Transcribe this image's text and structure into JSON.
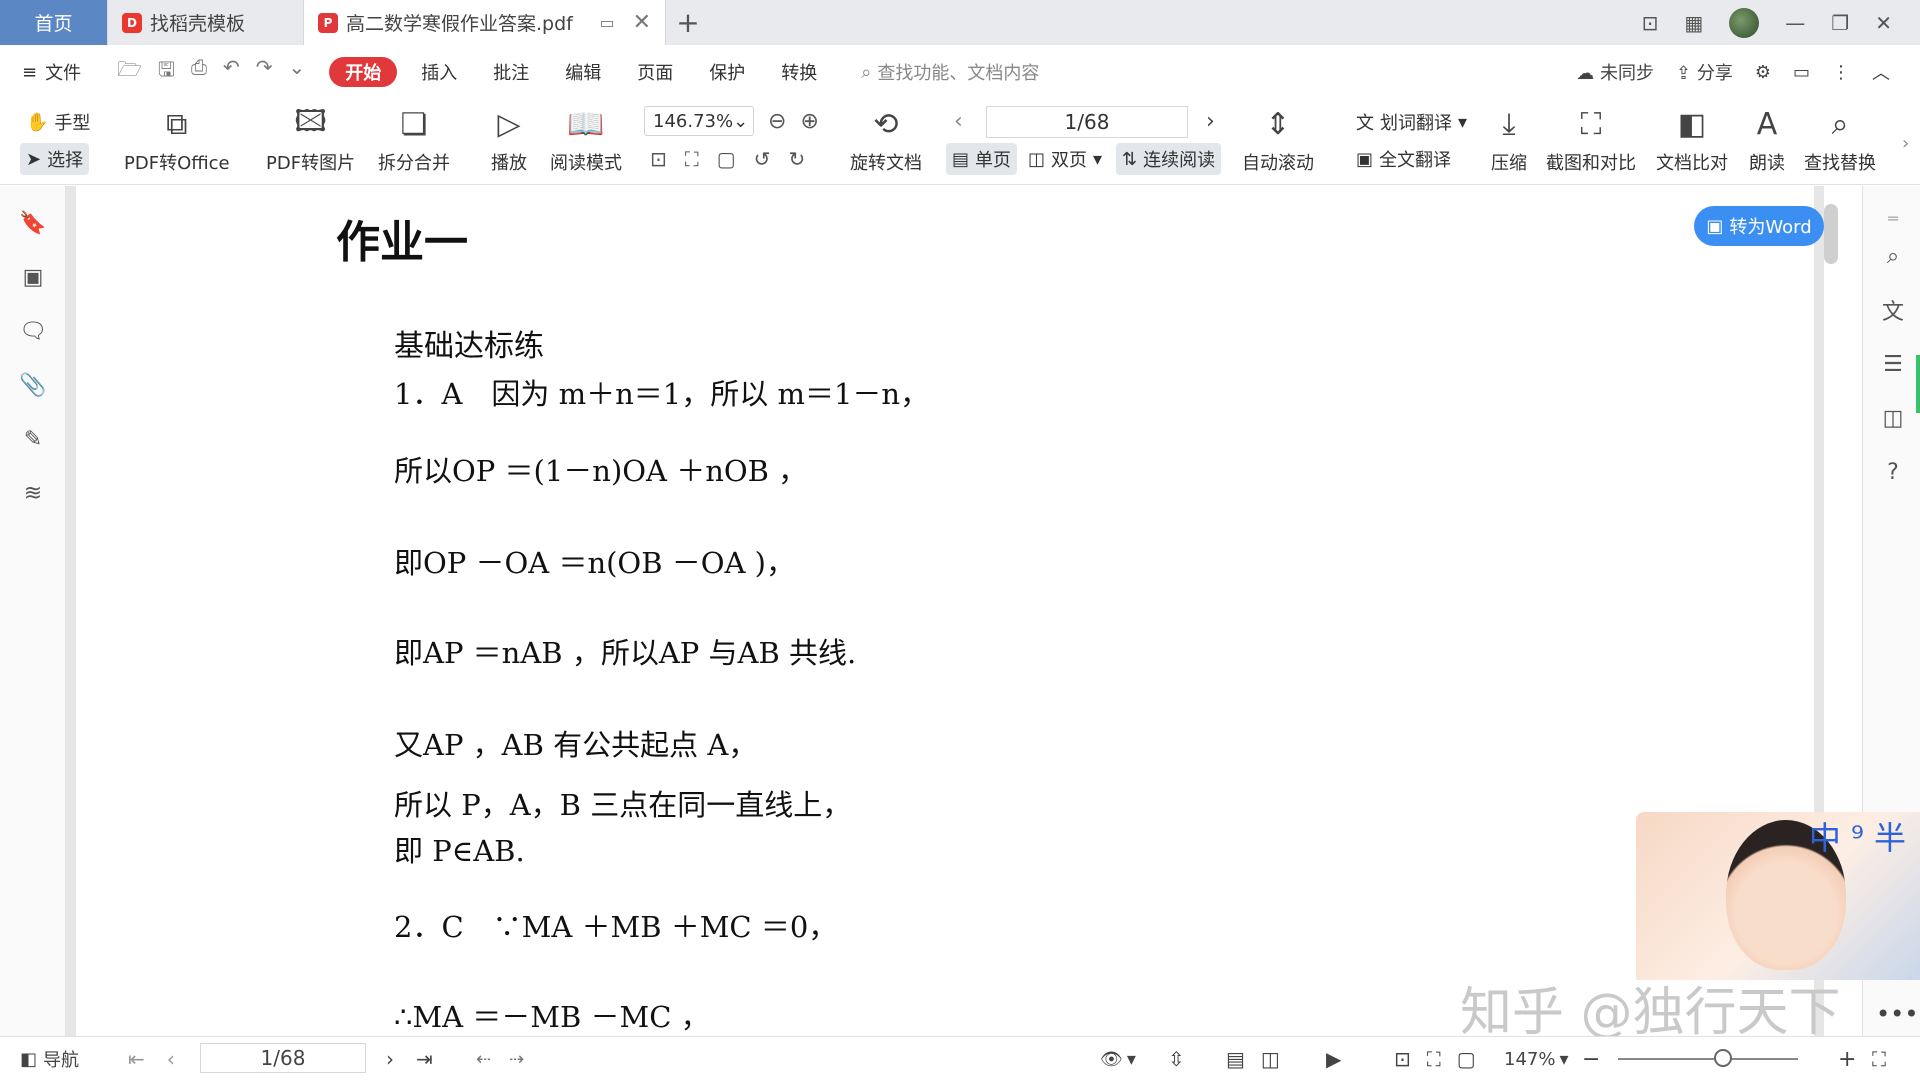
{
  "tabs": [
    {
      "label": "首页"
    },
    {
      "label": "找稻壳模板"
    },
    {
      "label": "高二数学寒假作业答案.pdf"
    }
  ],
  "menu": {
    "file": "文件",
    "items": [
      "开始",
      "插入",
      "批注",
      "编辑",
      "页面",
      "保护",
      "转换"
    ],
    "search_placeholder": "查找功能、文档内容",
    "sync": "未同步",
    "share": "分享"
  },
  "ribbon": {
    "hand": "手型",
    "select": "选择",
    "pdf_office": "PDF转Office",
    "pdf_image": "PDF转图片",
    "split_merge": "拆分合并",
    "play": "播放",
    "read_mode": "阅读模式",
    "zoom": "146.73%",
    "rotate_doc": "旋转文档",
    "page_indicator": "1/68",
    "single": "单页",
    "double": "双页",
    "continuous": "连续阅读",
    "auto_scroll": "自动滚动",
    "word_translate": "划词翻译",
    "full_translate": "全文翻译",
    "compress": "压缩",
    "screenshot": "截图和对比",
    "compare": "文档比对",
    "read_aloud": "朗读",
    "find_replace": "查找替换"
  },
  "document": {
    "title": "作业一",
    "section": "基础达标练",
    "lines": [
      "1．A　因为 m＋n＝1，所以 m＝1－n，",
      "所以OP ＝(1－n)OA ＋nOB ，",
      "即OP －OA ＝n(OB －OA )，",
      "即AP ＝nAB ，所以AP 与AB 共线.",
      "又AP ，AB 有公共起点 A，",
      "所以 P，A，B 三点在同一直线上，",
      "即 P∈AB.",
      "2．C　∵MA ＋MB ＋MC ＝0，",
      "∴MA ＝－MB －MC ，"
    ]
  },
  "to_word": "转为Word",
  "overlay": {
    "corner_text": "中 ⁹ 半",
    "watermark": "知乎 @独行天下"
  },
  "status": {
    "nav": "导航",
    "page": "1/68",
    "zoom": "147%"
  }
}
